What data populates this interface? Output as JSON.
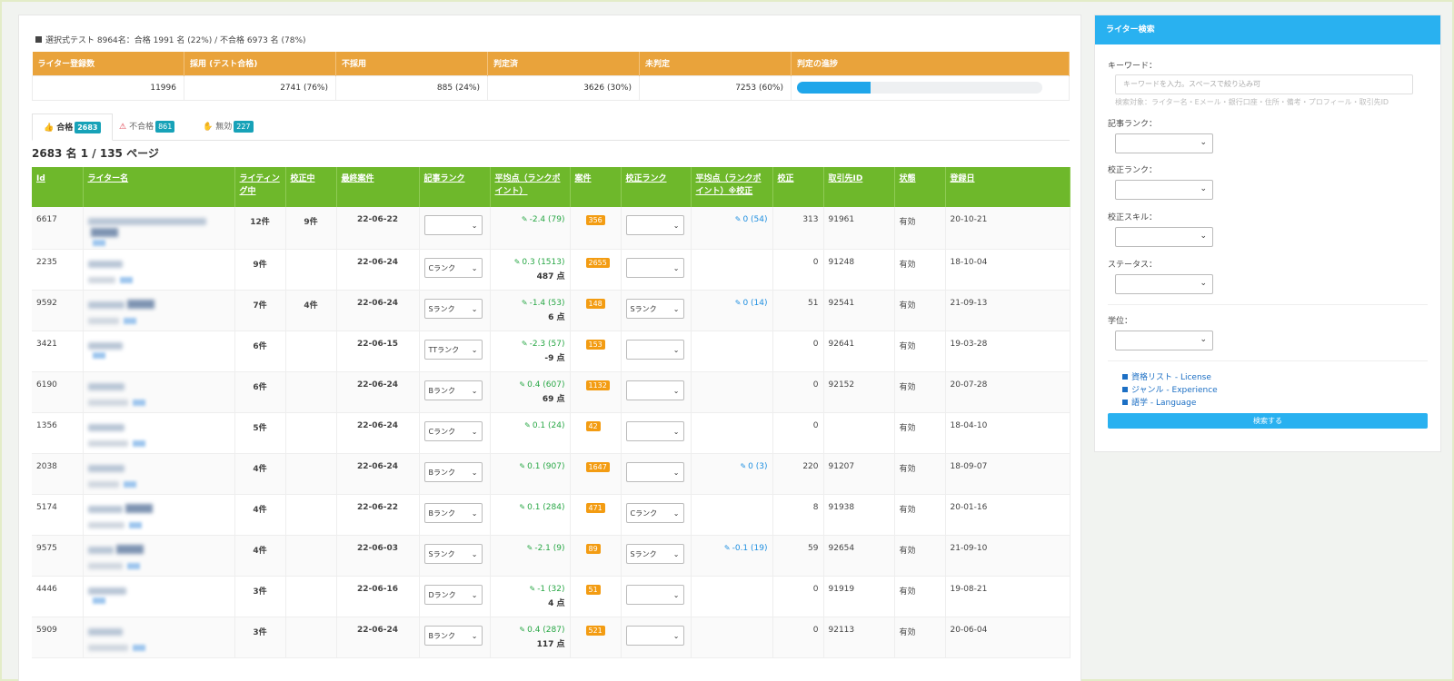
{
  "summary": {
    "text": "選択式テスト 8964名：合格 1991 名 (22%) / 不合格 6973 名 (78%)"
  },
  "stats": {
    "headers": [
      "ライター登録数",
      "採用 (テスト合格)",
      "不採用",
      "判定済",
      "未判定",
      "判定の進捗"
    ],
    "values": [
      "11996",
      "2741 (76%)",
      "885 (24%)",
      "3626 (30%)",
      "7253 (60%)"
    ],
    "progress": 0.3
  },
  "tabs": [
    {
      "label": "合格",
      "count": "2683",
      "icon": "thumbs-up-icon"
    },
    {
      "label": "不合格",
      "count": "861",
      "icon": "warning-icon"
    },
    {
      "label": "無効",
      "count": "227",
      "icon": "hand-icon"
    }
  ],
  "page_count": "2683 名 1 / 135 ページ",
  "table": {
    "headers": [
      "Id",
      "ライター名",
      "ライティング中",
      "校正中",
      "最終案件",
      "記事ランク",
      "平均点（ランクポイント）",
      "案件",
      "校正ランク",
      "平均点（ランクポイント）※校正",
      "校正",
      "取引先ID",
      "状態",
      "登録日"
    ],
    "rows": [
      {
        "id": "6617",
        "writing": "12件",
        "proof": "9件",
        "last": "22-06-22",
        "rank": "",
        "score": "-2.4 (79)",
        "pts": "",
        "cases": "356",
        "prank": "",
        "pscore": "0 (54)",
        "pcount": "313",
        "client": "91961",
        "status": "有効",
        "date": "20-10-21"
      },
      {
        "id": "2235",
        "writing": "9件",
        "proof": "",
        "last": "22-06-24",
        "rank": "Cランク",
        "score": "0.3 (1513)",
        "pts": "487 点",
        "cases": "2655",
        "prank": "",
        "pscore": "",
        "pcount": "0",
        "client": "91248",
        "status": "有効",
        "date": "18-10-04"
      },
      {
        "id": "9592",
        "writing": "7件",
        "proof": "4件",
        "last": "22-06-24",
        "rank": "Sランク",
        "score": "-1.4 (53)",
        "pts": "6 点",
        "cases": "148",
        "prank": "Sランク",
        "pscore": "0 (14)",
        "pcount": "51",
        "client": "92541",
        "status": "有効",
        "date": "21-09-13"
      },
      {
        "id": "3421",
        "writing": "6件",
        "proof": "",
        "last": "22-06-15",
        "rank": "TTランク",
        "score": "-2.3 (57)",
        "pts": "-9 点",
        "cases": "153",
        "prank": "",
        "pscore": "",
        "pcount": "0",
        "client": "92641",
        "status": "有効",
        "date": "19-03-28"
      },
      {
        "id": "6190",
        "writing": "6件",
        "proof": "",
        "last": "22-06-24",
        "rank": "Bランク",
        "score": "0.4 (607)",
        "pts": "69 点",
        "cases": "1132",
        "prank": "",
        "pscore": "",
        "pcount": "0",
        "client": "92152",
        "status": "有効",
        "date": "20-07-28"
      },
      {
        "id": "1356",
        "writing": "5件",
        "proof": "",
        "last": "22-06-24",
        "rank": "Cランク",
        "score": "0.1 (24)",
        "pts": "",
        "cases": "42",
        "prank": "",
        "pscore": "",
        "pcount": "0",
        "client": "",
        "status": "有効",
        "date": "18-04-10"
      },
      {
        "id": "2038",
        "writing": "4件",
        "proof": "",
        "last": "22-06-24",
        "rank": "Bランク",
        "score": "0.1 (907)",
        "pts": "",
        "cases": "1647",
        "prank": "",
        "pscore": "0 (3)",
        "pcount": "220",
        "client": "91207",
        "status": "有効",
        "date": "18-09-07"
      },
      {
        "id": "5174",
        "writing": "4件",
        "proof": "",
        "last": "22-06-22",
        "rank": "Bランク",
        "score": "0.1 (284)",
        "pts": "",
        "cases": "471",
        "prank": "Cランク",
        "pscore": "",
        "pcount": "8",
        "client": "91938",
        "status": "有効",
        "date": "20-01-16"
      },
      {
        "id": "9575",
        "writing": "4件",
        "proof": "",
        "last": "22-06-03",
        "rank": "Sランク",
        "score": "-2.1 (9)",
        "pts": "",
        "cases": "89",
        "prank": "Sランク",
        "pscore": "-0.1 (19)",
        "pcount": "59",
        "client": "92654",
        "status": "有効",
        "date": "21-09-10"
      },
      {
        "id": "4446",
        "writing": "3件",
        "proof": "",
        "last": "22-06-16",
        "rank": "Dランク",
        "score": "-1 (32)",
        "pts": "4 点",
        "cases": "51",
        "prank": "",
        "pscore": "",
        "pcount": "0",
        "client": "91919",
        "status": "有効",
        "date": "19-08-21"
      },
      {
        "id": "5909",
        "writing": "3件",
        "proof": "",
        "last": "22-06-24",
        "rank": "Bランク",
        "score": "0.4 (287)",
        "pts": "117 点",
        "cases": "521",
        "prank": "",
        "pscore": "",
        "pcount": "0",
        "client": "92113",
        "status": "有効",
        "date": "20-06-04"
      }
    ]
  },
  "sidebar": {
    "title": "ライター検索",
    "keyword_label": "キーワード：",
    "keyword_placeholder": "キーワードを入力。スペースで絞り込み可",
    "keyword_hint": "検索対象：ライター名・Eメール・銀行口座・住所・備考・プロフィール・取引先ID",
    "article_rank_label": "記事ランク：",
    "proof_rank_label": "校正ランク：",
    "proof_skill_label": "校正スキル：",
    "status_label": "ステータス：",
    "degree_label": "学位：",
    "links": [
      "資格リスト - License",
      "ジャンル - Experience",
      "語学 - Language"
    ],
    "search_button": "検索する"
  },
  "colors": {
    "orange": "#e9a33b",
    "green": "#6eb82b",
    "blue": "#29b1f0",
    "teal": "#17a2b8"
  }
}
